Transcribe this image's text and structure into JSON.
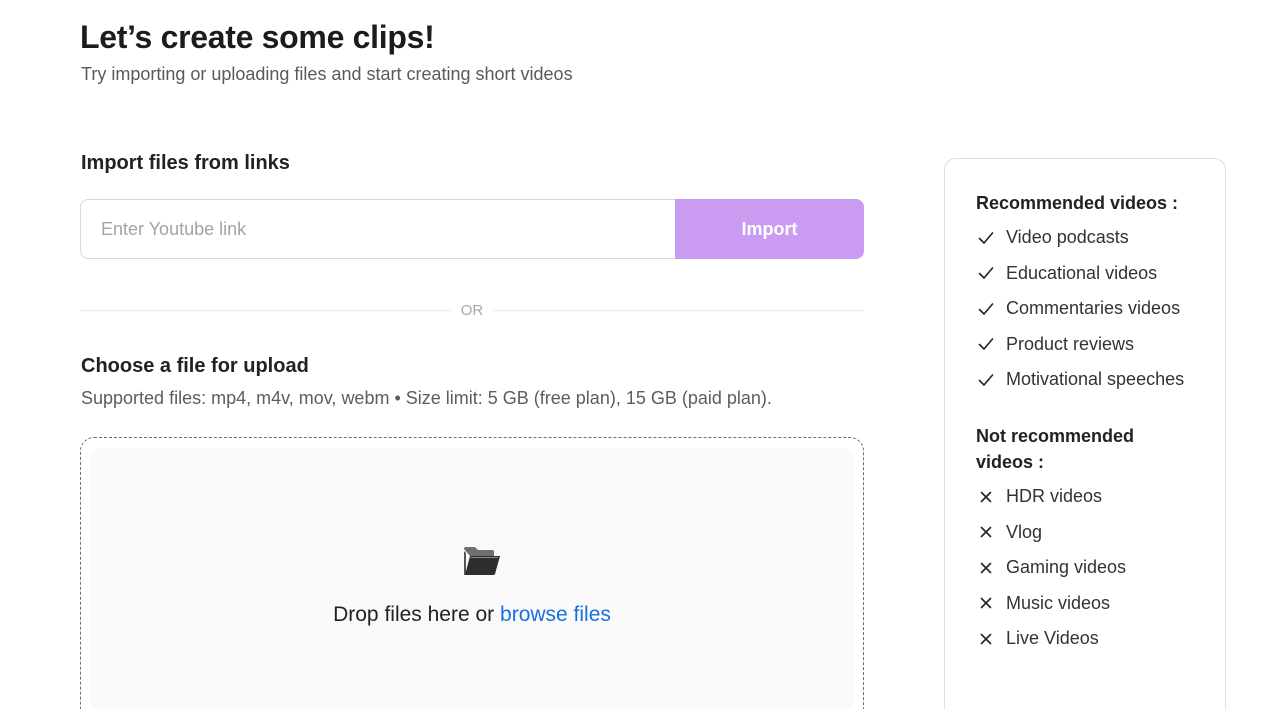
{
  "header": {
    "title": "Let’s create some clips!",
    "subtitle": "Try importing or uploading files and start creating short videos"
  },
  "import_section": {
    "heading": "Import files from links",
    "input_placeholder": "Enter Youtube link",
    "input_value": "",
    "button_label": "Import",
    "button_color": "#c99cf2"
  },
  "divider": {
    "label": "OR"
  },
  "upload_section": {
    "heading": "Choose a file for upload",
    "supported_text": "Supported files: mp4, m4v, mov, webm • Size limit: 5 GB (free plan), 15 GB (paid plan).",
    "drop_text": "Drop files here or",
    "browse_label": "browse files",
    "icon": "open-folder-icon",
    "link_color": "#1a6fe0"
  },
  "sidebar": {
    "recommended_heading": "Recommended videos :",
    "recommended_items": [
      "Video podcasts",
      "Educational videos",
      "Commentaries videos",
      "Product reviews",
      "Motivational speeches"
    ],
    "not_recommended_heading": "Not recommended videos :",
    "not_recommended_items": [
      "HDR videos",
      "Vlog",
      "Gaming videos",
      "Music videos",
      "Live Videos"
    ],
    "recommended_icon": "check-icon",
    "not_recommended_icon": "x-icon"
  }
}
